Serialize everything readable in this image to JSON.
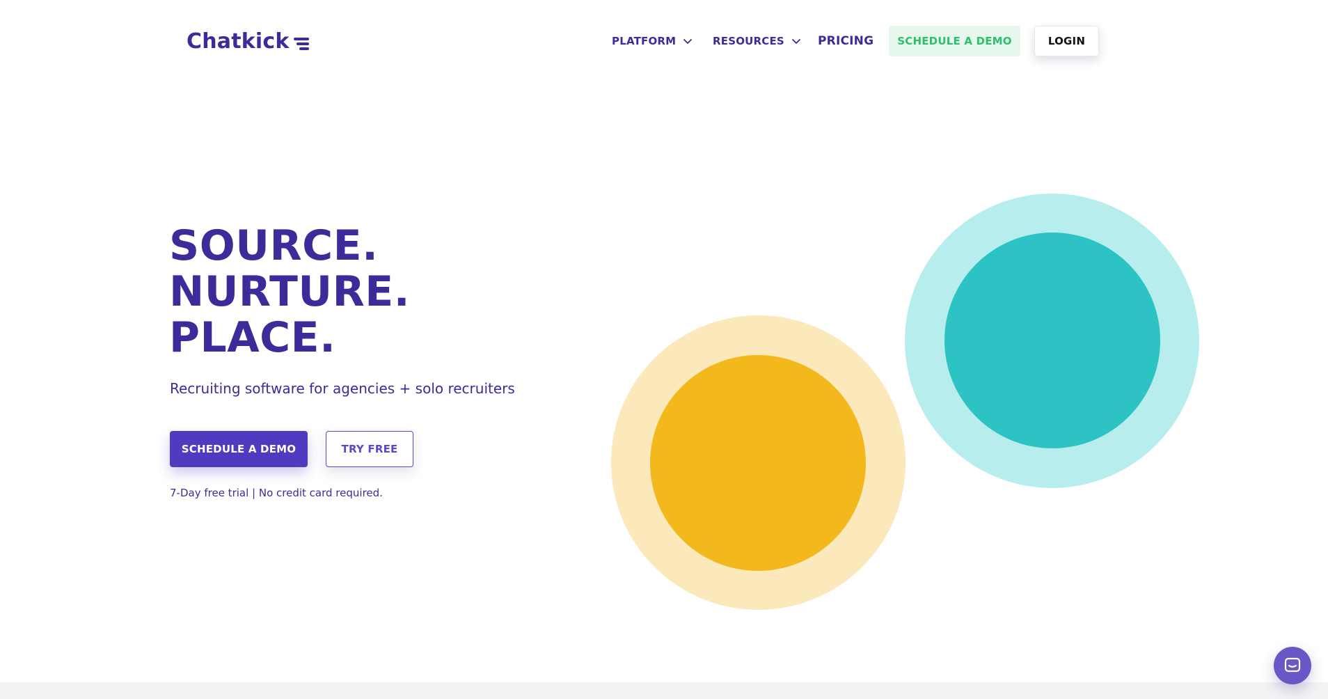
{
  "header": {
    "logo_text": "Chatkick",
    "nav": [
      {
        "label": "PLATFORM"
      },
      {
        "label": "RESOURCES"
      },
      {
        "label": "PRICING"
      }
    ],
    "schedule_demo_label": "SCHEDULE A DEMO",
    "login_label": "LOGIN"
  },
  "hero": {
    "title_lines": [
      "SOURCE.",
      "NURTURE.",
      "PLACE."
    ],
    "subtitle": "Recruiting software for agencies + solo recruiters",
    "primary_cta": "SCHEDULE A DEMO",
    "secondary_cta": "TRY FREE",
    "note": "7-Day free trial | No credit card required."
  },
  "colors": {
    "brand": "#3f2a9a",
    "primary_button": "#4f3bbf",
    "demo_button_bg": "#e6f7ee",
    "demo_button_text": "#2fbf6a",
    "yellow_outer": "#fbe8bb",
    "yellow_inner": "#f2b81c",
    "teal_outer": "#b7eeed",
    "teal_inner": "#2dc3c4",
    "chat_launcher": "#6b56c7"
  },
  "icons": {
    "logo_mark": "menu-lines-icon",
    "nav_dropdown": "chevron-down-icon",
    "chat": "chat-bubble-icon"
  }
}
